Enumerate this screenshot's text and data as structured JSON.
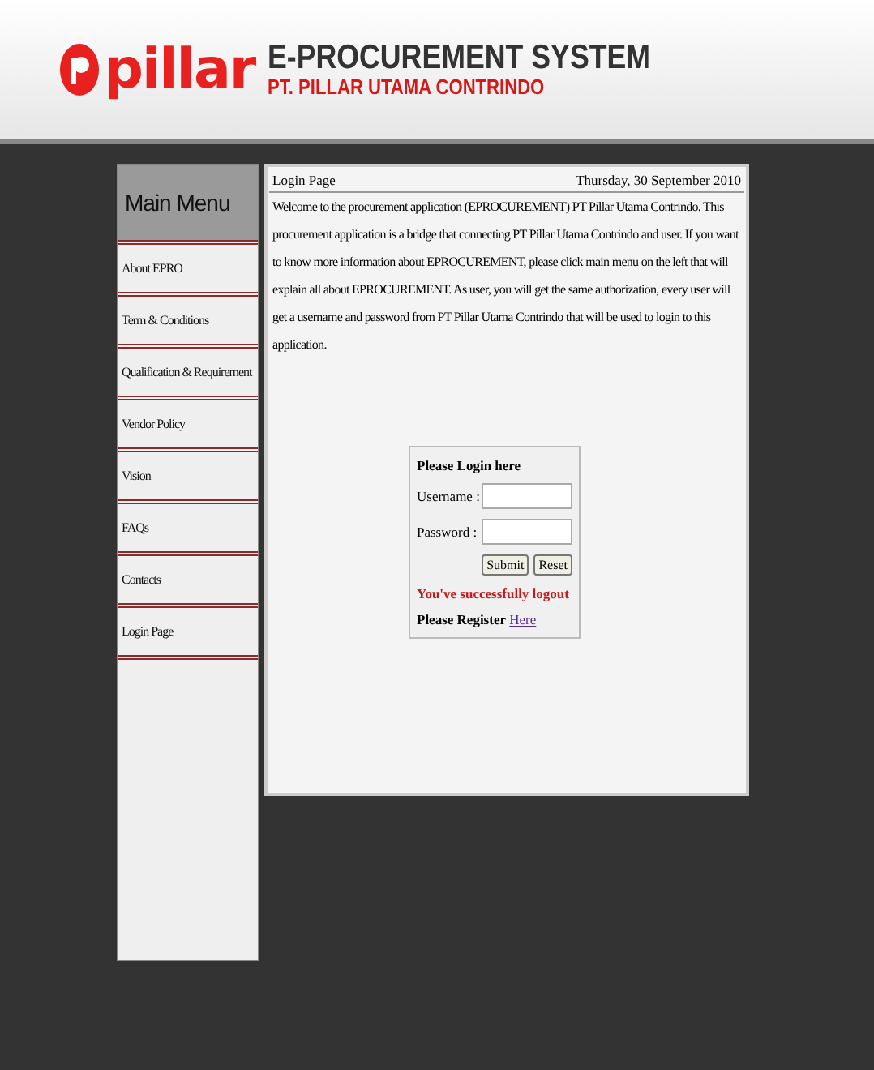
{
  "header": {
    "logo": "pillar",
    "title": "E-PROCUREMENT SYSTEM",
    "subtitle": "PT. PILLAR UTAMA CONTRINDO"
  },
  "sidebar": {
    "title": "Main Menu",
    "items": [
      {
        "label": "About EPRO"
      },
      {
        "label": "Term & Conditions"
      },
      {
        "label": "Qualification & Requirement"
      },
      {
        "label": "Vendor Policy"
      },
      {
        "label": "Vision"
      },
      {
        "label": "FAQs"
      },
      {
        "label": "Contacts"
      },
      {
        "label": "Login Page"
      }
    ]
  },
  "content": {
    "page_title": "Login Page",
    "date": "Thursday, 30 September 2010",
    "intro": "Welcome to the procurement application (EPROCUREMENT) PT Pillar Utama Contrindo. This procurement application is a bridge that connecting PT Pillar Utama Contrindo and user. If you want to know more information about EPROCUREMENT, please click main menu on the left that will explain all about EPROCUREMENT. As user, you will get the same authorization, every user will get a username and password from PT Pillar Utama Contrindo that will be used to login to this application."
  },
  "login": {
    "title": "Please Login here",
    "fields": [
      {
        "label": "Username :"
      },
      {
        "label": "Password :"
      }
    ],
    "buttons": [
      "Submit",
      "Reset"
    ],
    "message": "You've successfully logout",
    "register_label": "Please Register",
    "register_link": "Here"
  }
}
